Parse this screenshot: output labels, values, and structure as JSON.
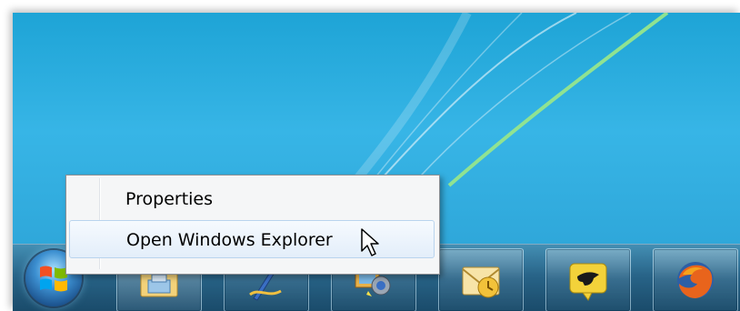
{
  "context_menu": {
    "items": [
      {
        "label": "Properties",
        "highlighted": false
      },
      {
        "label": "Open Windows Explorer",
        "highlighted": true
      }
    ]
  },
  "taskbar": {
    "start_button": "windows-start-orb-icon",
    "buttons": [
      {
        "icon": "windows-explorer-folder-icon",
        "active": true
      },
      {
        "icon": "pen-drawing-app-icon",
        "active": false
      },
      {
        "icon": "photo-gallery-app-icon",
        "active": false
      },
      {
        "icon": "outlook-email-icon",
        "active": false
      },
      {
        "icon": "bird-messaging-app-icon",
        "active": false
      },
      {
        "icon": "firefox-browser-icon",
        "active": false
      }
    ]
  },
  "colors": {
    "desktop_blue": "#2aa6d8",
    "menu_highlight": "#e3eefa",
    "menu_border": "#8d8f93"
  }
}
